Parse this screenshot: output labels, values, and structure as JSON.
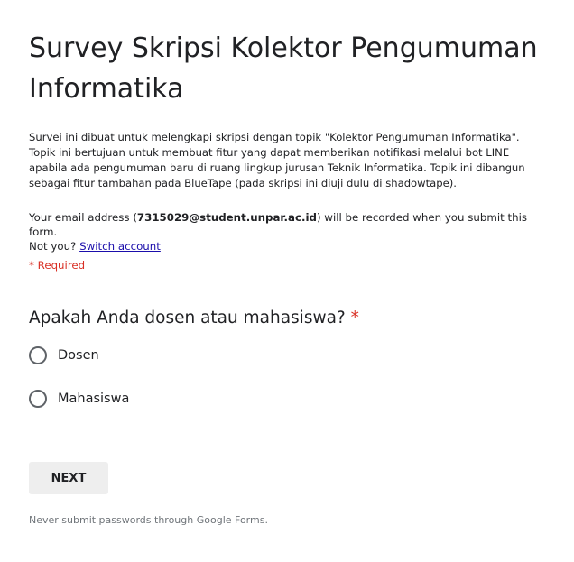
{
  "form": {
    "title": "Survey Skripsi Kolektor Pengumuman Informatika",
    "description": "Survei ini dibuat untuk melengkapi skripsi dengan topik \"Kolektor Pengumuman Informatika\". Topik ini bertujuan untuk membuat fitur yang dapat memberikan notifikasi melalui bot LINE apabila ada pengumuman baru di ruang lingkup jurusan Teknik Informatika. Topik ini dibangun sebagai fitur tambahan pada BlueTape (pada skripsi ini diuji dulu di shadowtape).",
    "email_prefix": "Your email address (",
    "email": "7315029@student.unpar.ac.id",
    "email_suffix": ") will be recorded when you submit this form.",
    "not_you": "Not you?",
    "switch_account": "Switch account",
    "required_note": "* Required"
  },
  "question": {
    "title": "Apakah Anda dosen atau mahasiswa?",
    "required_mark": "*",
    "options": [
      {
        "label": "Dosen",
        "selected": false
      },
      {
        "label": "Mahasiswa",
        "selected": false
      }
    ]
  },
  "actions": {
    "next_label": "NEXT"
  },
  "footer": {
    "note": "Never submit passwords through Google Forms."
  }
}
